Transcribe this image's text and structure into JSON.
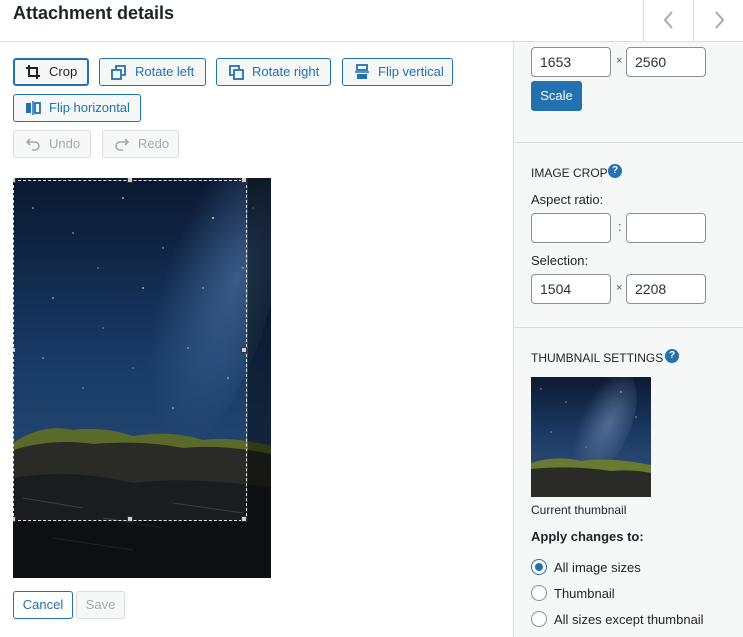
{
  "header": {
    "title": "Attachment details",
    "prev_icon": "chevron-left-icon",
    "next_icon": "chevron-right-icon"
  },
  "toolbar": {
    "crop": "Crop",
    "rotate_left": "Rotate left",
    "rotate_right": "Rotate right",
    "flip_vertical": "Flip vertical",
    "flip_horizontal": "Flip horizontal",
    "undo": "Undo",
    "redo": "Redo"
  },
  "footer": {
    "cancel": "Cancel",
    "save": "Save"
  },
  "scale": {
    "width": "1653",
    "times": "×",
    "height": "2560",
    "button": "Scale"
  },
  "image_crop": {
    "title": "IMAGE CROP",
    "help": "?",
    "aspect_label": "Aspect ratio:",
    "aspect_w": "",
    "aspect_sep": ":",
    "aspect_h": "",
    "selection_label": "Selection:",
    "selection_w": "1504",
    "selection_times": "×",
    "selection_h": "2208"
  },
  "thumbnail": {
    "title": "THUMBNAIL SETTINGS",
    "help": "?",
    "caption": "Current thumbnail",
    "apply_label": "Apply changes to:",
    "options": [
      {
        "label": "All image sizes",
        "checked": true
      },
      {
        "label": "Thumbnail",
        "checked": false
      },
      {
        "label": "All sizes except thumbnail",
        "checked": false
      }
    ]
  },
  "colors": {
    "accent": "#2271b1",
    "sidebar_bg": "#f6f7f7",
    "border": "#dcdcde"
  }
}
